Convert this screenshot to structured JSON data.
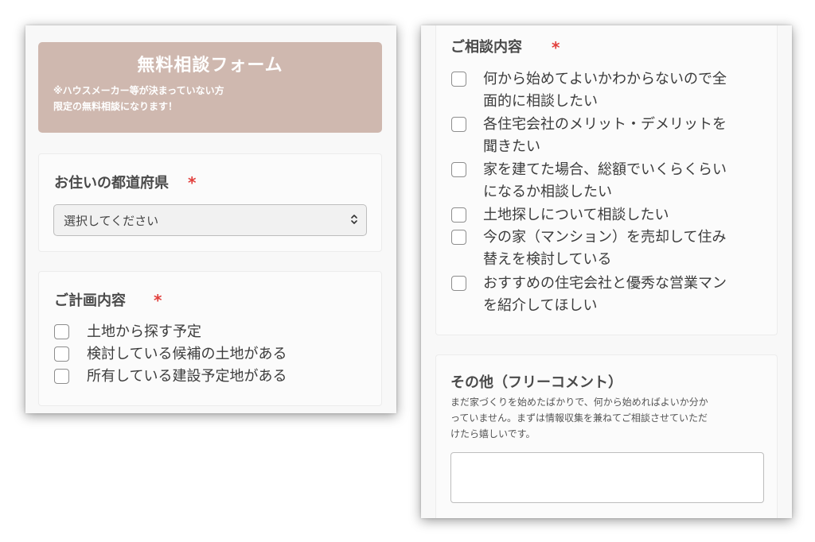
{
  "header": {
    "title": "無料相談フォーム",
    "note_line1": "※ハウスメーカー等が決まっていない方",
    "note_line2": "限定の無料相談になります！"
  },
  "prefecture": {
    "label": "お住いの都道府県",
    "required": "*",
    "select_placeholder": "選択してください"
  },
  "plan": {
    "label": "ご計画内容",
    "required": "*",
    "options": [
      "土地から探す予定",
      "検討している候補の土地がある",
      "所有している建設予定地がある"
    ]
  },
  "consult": {
    "label": "ご相談内容",
    "required": "*",
    "options": [
      {
        "line1": "何から始めてよいかわからないので全",
        "line2": "面的に相談したい"
      },
      {
        "line1": "各住宅会社のメリット・デメリットを",
        "line2": "聞きたい"
      },
      {
        "line1": "家を建てた場合、総額でいくらくらい",
        "line2": "になるか相談したい"
      },
      {
        "line1": "土地探しについて相談したい",
        "line2": ""
      },
      {
        "line1": "今の家（マンション）を売却して住み",
        "line2": "替えを検討している"
      },
      {
        "line1": "おすすめの住宅会社と優秀な営業マン",
        "line2": "を紹介してほしい"
      }
    ]
  },
  "other": {
    "label": "その他（フリーコメント）",
    "hint_line1": "まだ家づくりを始めたばかりで、何から始めればよいか分か",
    "hint_line2": "っていません。まずは情報収集を兼ねてご相談させていただ",
    "hint_line3": "けたら嬉しいです。",
    "comment_value": ""
  }
}
